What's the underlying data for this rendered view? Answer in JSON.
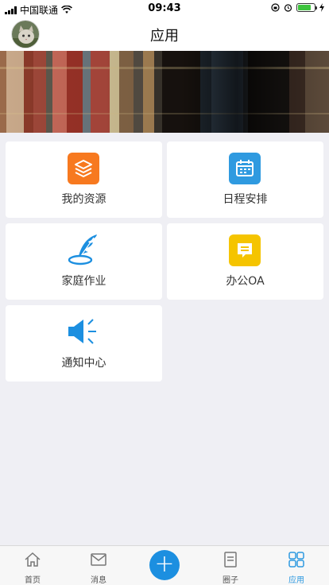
{
  "status_bar": {
    "carrier": "中国联通",
    "time": "09:43",
    "battery_percent": 80
  },
  "header": {
    "title": "应用"
  },
  "apps": [
    {
      "label": "我的资源",
      "icon": "layers-icon",
      "color": "#f7791f"
    },
    {
      "label": "日程安排",
      "icon": "calendar-icon",
      "color": "#2f9ae0"
    },
    {
      "label": "家庭作业",
      "icon": "feather-quill-icon",
      "color": "#1c8fe0"
    },
    {
      "label": "办公OA",
      "icon": "message-icon",
      "color": "#f5c400"
    },
    {
      "label": "通知中心",
      "icon": "speaker-icon",
      "color": "#1c8fe0"
    }
  ],
  "tabs": [
    {
      "label": "首页",
      "icon": "home-icon"
    },
    {
      "label": "消息",
      "icon": "mail-icon"
    },
    {
      "label": "圈子",
      "icon": "document-icon"
    },
    {
      "label": "应用",
      "icon": "grid-apps-icon",
      "active": true
    }
  ],
  "add_button": {
    "label": "+"
  }
}
